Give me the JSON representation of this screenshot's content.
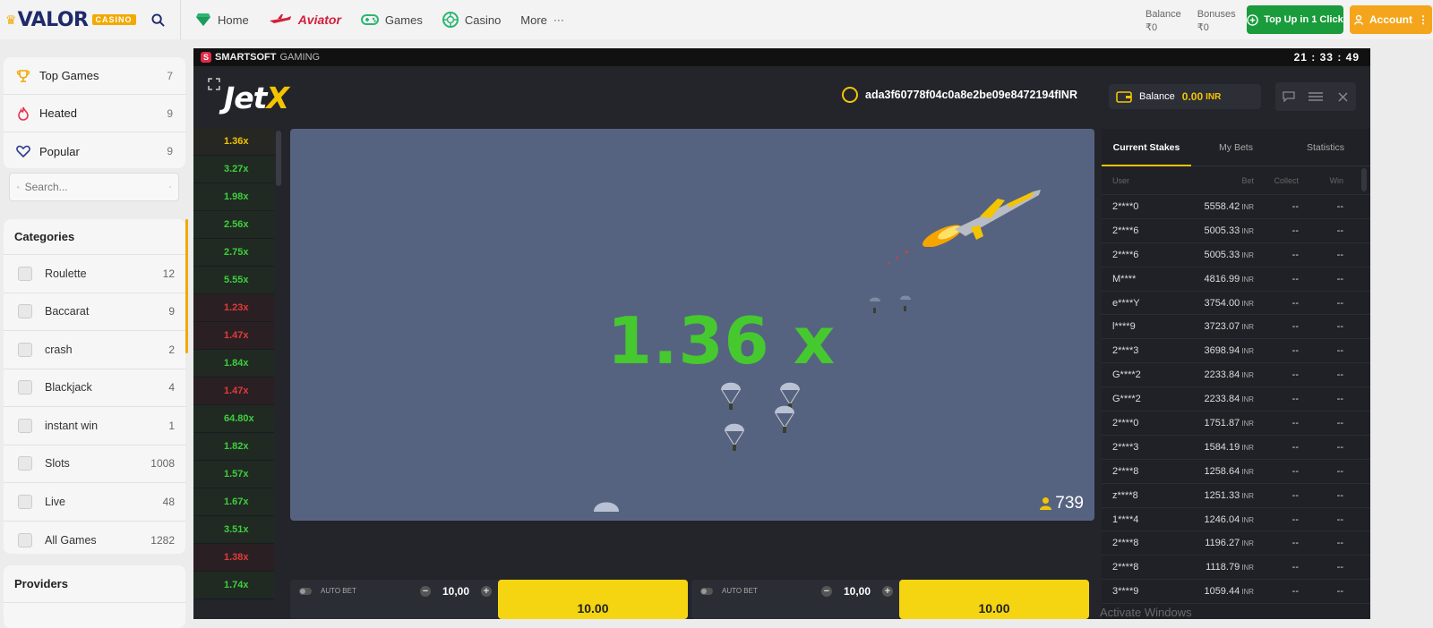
{
  "topbar": {
    "logo_main": "VALOR",
    "logo_sub": "CASINO",
    "nav": [
      {
        "label": "Home",
        "icon": "diamond-icon"
      },
      {
        "label": "Aviator",
        "icon": "plane-icon"
      },
      {
        "label": "Games",
        "icon": "gamepad-icon"
      },
      {
        "label": "Casino",
        "icon": "casino-chip-icon"
      },
      {
        "label": "More",
        "icon": "ellipsis-icon"
      }
    ],
    "balance_label": "Balance",
    "balance_value": "₹0",
    "bonuses_label": "Bonuses",
    "bonuses_value": "₹0",
    "topup_label": "Top Up in 1 Click",
    "account_label": "Account"
  },
  "sidebar": {
    "quick": [
      {
        "label": "Top Games",
        "count": "7",
        "icon": "trophy-icon"
      },
      {
        "label": "Heated",
        "count": "9",
        "icon": "flame-icon"
      },
      {
        "label": "Popular",
        "count": "9",
        "icon": "heart-icon"
      }
    ],
    "search_placeholder": "Search...",
    "categories_title": "Categories",
    "categories": [
      {
        "label": "Roulette",
        "count": "12"
      },
      {
        "label": "Baccarat",
        "count": "9"
      },
      {
        "label": "crash",
        "count": "2"
      },
      {
        "label": "Blackjack",
        "count": "4"
      },
      {
        "label": "instant win",
        "count": "1"
      },
      {
        "label": "Slots",
        "count": "1008"
      },
      {
        "label": "Live",
        "count": "48"
      },
      {
        "label": "All Games",
        "count": "1282"
      }
    ],
    "providers_title": "Providers",
    "accent_color": "#f2a900"
  },
  "game": {
    "provider": "SMARTSOFT",
    "provider_sub": "GAMING",
    "clock": "21 : 33 : 49",
    "title_main": "Jet",
    "title_x": "X",
    "user_id": "ada3f60778f04c0a8e2be09e8472194fINR",
    "balance_label": "Balance",
    "balance_amount": "0.00",
    "balance_currency": "INR",
    "current_multiplier": "1.36 x",
    "players_online": "739",
    "history": [
      {
        "v": "1.36x",
        "c": "y"
      },
      {
        "v": "3.27x",
        "c": "g"
      },
      {
        "v": "1.98x",
        "c": "g"
      },
      {
        "v": "2.56x",
        "c": "g"
      },
      {
        "v": "2.75x",
        "c": "g"
      },
      {
        "v": "5.55x",
        "c": "g"
      },
      {
        "v": "1.23x",
        "c": "r"
      },
      {
        "v": "1.47x",
        "c": "r"
      },
      {
        "v": "1.84x",
        "c": "g"
      },
      {
        "v": "1.47x",
        "c": "r"
      },
      {
        "v": "64.80x",
        "c": "g"
      },
      {
        "v": "1.82x",
        "c": "g"
      },
      {
        "v": "1.57x",
        "c": "g"
      },
      {
        "v": "1.67x",
        "c": "g"
      },
      {
        "v": "3.51x",
        "c": "g"
      },
      {
        "v": "1.38x",
        "c": "r"
      },
      {
        "v": "1.74x",
        "c": "g"
      }
    ],
    "bet_panels": [
      {
        "auto_label": "AUTO BET",
        "stake": "10,00",
        "button_text": "10.00"
      },
      {
        "auto_label": "AUTO BET",
        "stake": "10,00",
        "button_text": "10.00"
      }
    ],
    "tabs": [
      "Current Stakes",
      "My Bets",
      "Statistics"
    ],
    "table_headers": [
      "User",
      "Bet",
      "Collect",
      "Win"
    ],
    "stakes": [
      {
        "user": "2****0",
        "bet": "5558.42",
        "cur": "INR",
        "collect": "--",
        "win": "--"
      },
      {
        "user": "2****6",
        "bet": "5005.33",
        "cur": "INR",
        "collect": "--",
        "win": "--"
      },
      {
        "user": "2****6",
        "bet": "5005.33",
        "cur": "INR",
        "collect": "--",
        "win": "--"
      },
      {
        "user": "M****",
        "bet": "4816.99",
        "cur": "INR",
        "collect": "--",
        "win": "--"
      },
      {
        "user": "e****Y",
        "bet": "3754.00",
        "cur": "INR",
        "collect": "--",
        "win": "--"
      },
      {
        "user": "l****9",
        "bet": "3723.07",
        "cur": "INR",
        "collect": "--",
        "win": "--"
      },
      {
        "user": "2****3",
        "bet": "3698.94",
        "cur": "INR",
        "collect": "--",
        "win": "--"
      },
      {
        "user": "G****2",
        "bet": "2233.84",
        "cur": "INR",
        "collect": "--",
        "win": "--"
      },
      {
        "user": "G****2",
        "bet": "2233.84",
        "cur": "INR",
        "collect": "--",
        "win": "--"
      },
      {
        "user": "2****0",
        "bet": "1751.87",
        "cur": "INR",
        "collect": "--",
        "win": "--"
      },
      {
        "user": "2****3",
        "bet": "1584.19",
        "cur": "INR",
        "collect": "--",
        "win": "--"
      },
      {
        "user": "2****8",
        "bet": "1258.64",
        "cur": "INR",
        "collect": "--",
        "win": "--"
      },
      {
        "user": "z****8",
        "bet": "1251.33",
        "cur": "INR",
        "collect": "--",
        "win": "--"
      },
      {
        "user": "1****4",
        "bet": "1246.04",
        "cur": "INR",
        "collect": "--",
        "win": "--"
      },
      {
        "user": "2****8",
        "bet": "1196.27",
        "cur": "INR",
        "collect": "--",
        "win": "--"
      },
      {
        "user": "2****8",
        "bet": "1118.79",
        "cur": "INR",
        "collect": "--",
        "win": "--"
      },
      {
        "user": "3****9",
        "bet": "1059.44",
        "cur": "INR",
        "collect": "--",
        "win": "--"
      }
    ],
    "colors": {
      "multiplier": "#46c92f",
      "accent": "#f5c400",
      "field": "#566380",
      "loss": "#e03b3b"
    }
  },
  "watermark": "Activate Windows"
}
